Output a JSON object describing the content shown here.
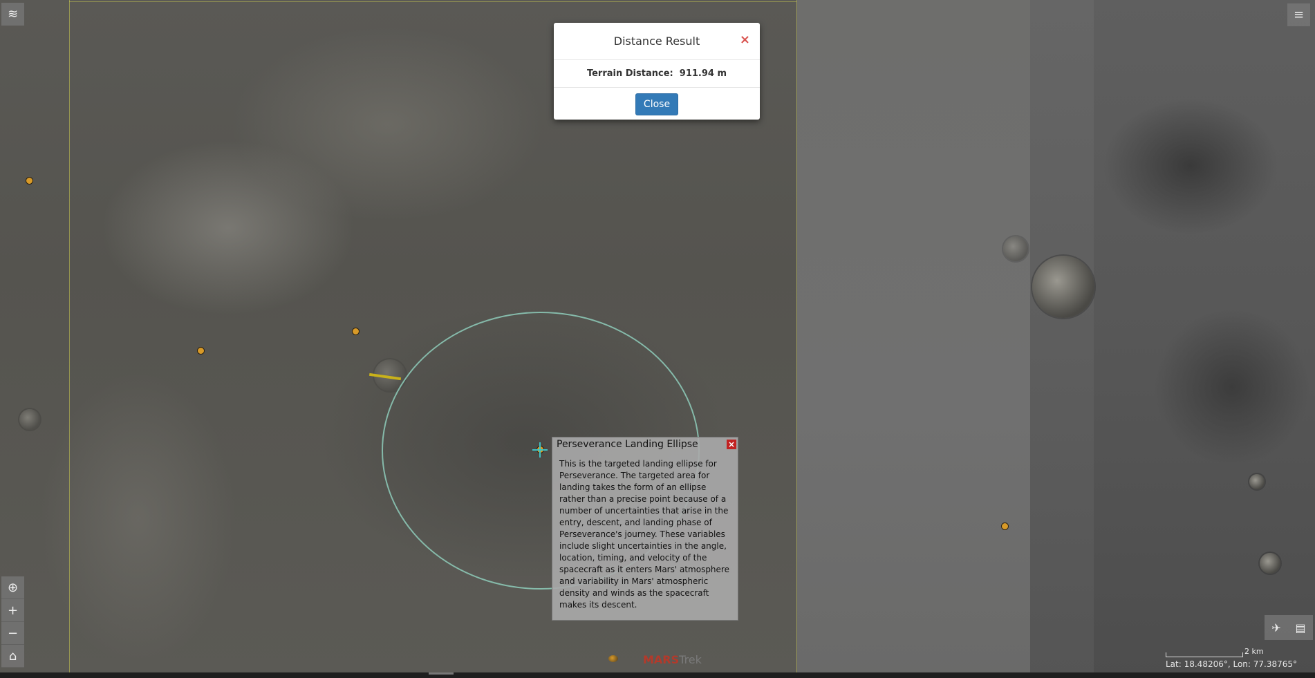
{
  "map": {
    "markers": [
      {
        "name": "marker-1"
      },
      {
        "name": "marker-2"
      },
      {
        "name": "marker-3"
      },
      {
        "name": "marker-4"
      },
      {
        "name": "marker-5"
      }
    ],
    "marker_color": "#d89a28",
    "ellipse_color": "#96dcc8"
  },
  "distance_modal": {
    "title": "Distance Result",
    "close_x": "×",
    "result_label": "Terrain Distance:",
    "result_value": "911.94 m",
    "close_button": "Close",
    "close_button_color": "#337ab7"
  },
  "info_popup": {
    "title": "Perseverance Landing Ellipse",
    "close_x": "×",
    "text": "This is the targeted landing ellipse for Perseverance. The targeted area for landing takes the form of an ellipse rather than a precise point because of a number of uncertainties that arise in the entry, descent, and landing phase of Perseverance's journey. These variables include slight uncertainties in the angle, location, timing, and velocity of the spacecraft as it enters Mars' atmosphere and variability in Mars' atmospheric density and winds as the spacecraft makes its descent."
  },
  "controls": {
    "layers_icon": "≋",
    "globe_icon": "⊕",
    "zoom_in": "+",
    "zoom_out": "−",
    "home_icon": "⌂",
    "menu_icon": "≡",
    "fly_icon": "✈",
    "map_icon": "▤"
  },
  "scale": {
    "label": "2 km"
  },
  "coordinates": "Lat: 18.48206°, Lon: 77.38765°",
  "brand": {
    "mars": "MARS",
    "trek": "Trek"
  }
}
